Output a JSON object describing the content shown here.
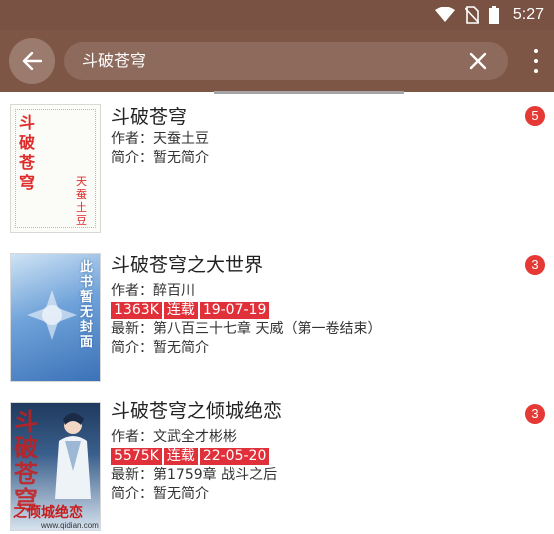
{
  "status_bar": {
    "time": "5:27",
    "icons": [
      "wifi-icon",
      "no-sim-icon",
      "battery-icon"
    ]
  },
  "toolbar": {
    "back_icon": "arrow-left-icon",
    "search_value": "斗破苍穹",
    "clear_icon": "close-icon",
    "more_icon": "more-vert-icon"
  },
  "colors": {
    "status_bar": "#7a5243",
    "toolbar": "#7d5646",
    "search_box": "#8e6a5c",
    "tag": "#e0313a",
    "badge": "#e53935"
  },
  "results": [
    {
      "title": "斗破苍穹",
      "author_label": "作者：",
      "author": "天蚕土豆",
      "tags": [],
      "latest_label": "",
      "latest": "",
      "intro_label": "简介：",
      "intro": "暂无简介",
      "badge": "5",
      "cover": {
        "title_text": "斗破苍穹",
        "author_text": "天蚕土豆"
      }
    },
    {
      "title": "斗破苍穹之大世界",
      "author_label": "作者：",
      "author": "醉百川",
      "tags": [
        "1363K",
        "连载",
        "19-07-19"
      ],
      "latest_label": "最新：",
      "latest": "第八百三十七章 天威（第一卷结束）",
      "intro_label": "简介：",
      "intro": "暂无简介",
      "badge": "3",
      "cover": {
        "title_text": "此书暂无封面"
      }
    },
    {
      "title": "斗破苍穹之倾城绝恋",
      "author_label": "作者：",
      "author": "文武全才彬彬",
      "tags": [
        "5575K",
        "连载",
        "22-05-20"
      ],
      "latest_label": "最新：",
      "latest": "第1759章 战斗之后",
      "intro_label": "简介：",
      "intro": "暂无简介",
      "badge": "3",
      "cover": {
        "title_text": "斗破苍穹",
        "subtitle_text": "之倾城绝恋",
        "url_text": "www.qidian.com"
      }
    }
  ]
}
